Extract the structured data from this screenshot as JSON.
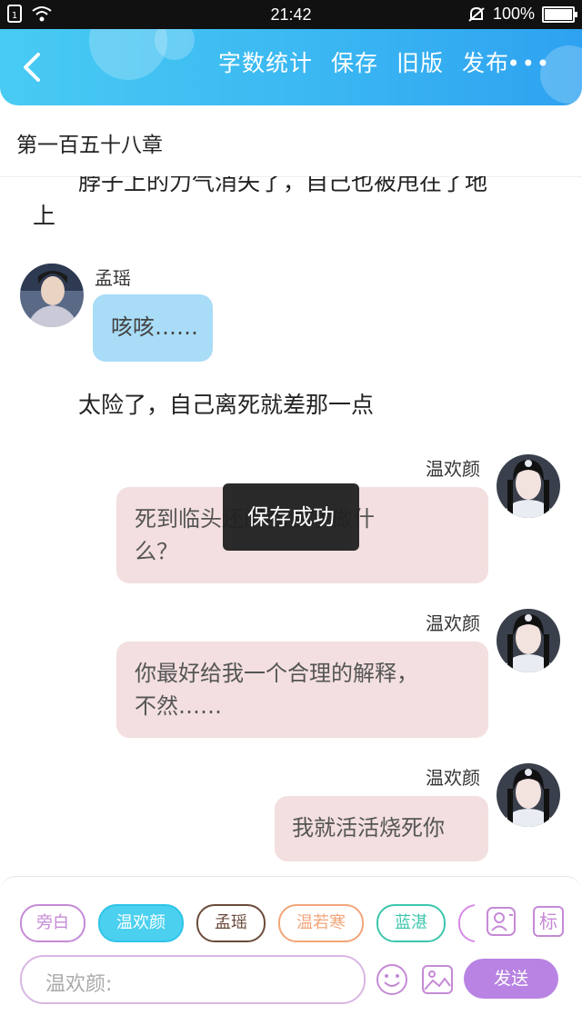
{
  "status": {
    "time": "21:42",
    "battery": "100%"
  },
  "toolbar": {
    "word_count": "字数统计",
    "save": "保存",
    "old_version": "旧版",
    "publish": "发布",
    "more": "•••"
  },
  "chapter": {
    "title": "第一百五十八章"
  },
  "content": {
    "narration_1_line1": "脖子上的力气消失了，自己也被甩在了地",
    "narration_1_line2": "上",
    "message_1": {
      "speaker": "孟瑶",
      "text": "咳咳……"
    },
    "narration_2": "太险了，自己离死就差那一点",
    "message_2": {
      "speaker": "温欢颜",
      "line1": "死到临头还问我名字做什",
      "line2": "么？"
    },
    "message_3": {
      "speaker": "温欢颜",
      "line1": "你最好给我一个合理的解释，",
      "line2": "不然……"
    },
    "message_4": {
      "speaker": "温欢颜",
      "text": "我就活活烧死你"
    }
  },
  "toast": {
    "text": "保存成功"
  },
  "composer": {
    "chips": [
      {
        "label": "旁白",
        "color": "#c58ad6"
      },
      {
        "label": "温欢颜",
        "color": "#2fc4e8",
        "selected": true
      },
      {
        "label": "孟瑶",
        "color": "#6b4a3a"
      },
      {
        "label": "温若寒",
        "color": "#f2a57a"
      },
      {
        "label": "蓝湛",
        "color": "#3cc6ad"
      }
    ],
    "tag_button": "标",
    "input_placeholder": "温欢颜:",
    "send": "发送"
  },
  "colors": {
    "accent": "#2ea2f0",
    "send": "#b883e2",
    "pink_bubble": "#f3dfdf",
    "blue_bubble": "#a9dcf6"
  }
}
